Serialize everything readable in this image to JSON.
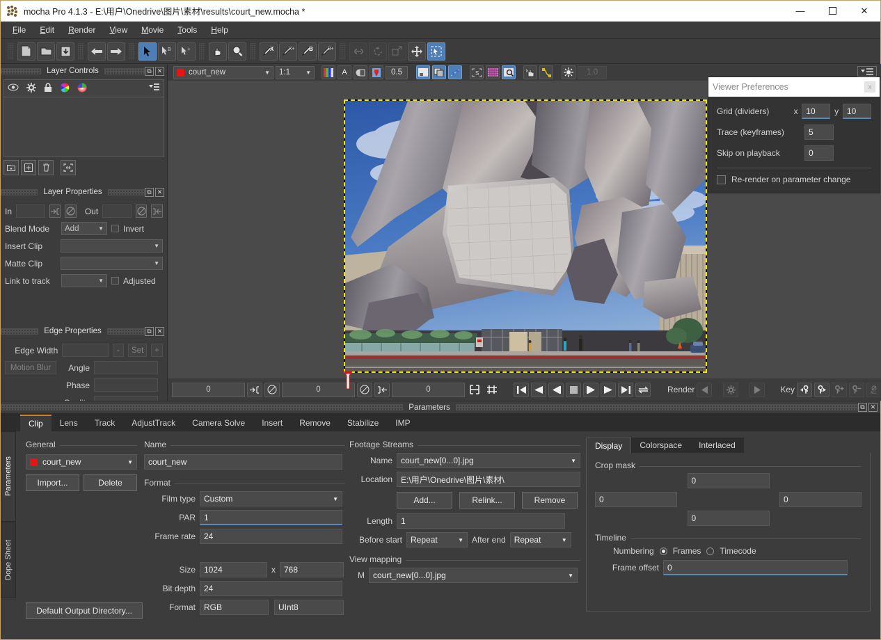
{
  "window": {
    "title": "mocha Pro 4.1.3 - E:\\用户\\Onedrive\\图片\\素材\\results\\court_new.mocha *",
    "minimize": "—",
    "maximize": "☐",
    "close": "✕"
  },
  "menu": [
    "File",
    "Edit",
    "Render",
    "View",
    "Movie",
    "Tools",
    "Help"
  ],
  "toolbar": {
    "icons": [
      "new-icon",
      "open-icon",
      "save-icon",
      "back-arrow-icon",
      "forward-arrow-icon",
      "select-pointer-icon",
      "select-b-pointer-icon",
      "add-pointer-icon",
      "pan-hand-icon",
      "zoom-magnifier-icon",
      "pen-x-icon",
      "pen-xplus-icon",
      "pen-b-icon",
      "pen-bplus-icon",
      "link-icon",
      "rotate-icon",
      "transform-icon",
      "move-icon",
      "marquee-select-icon"
    ]
  },
  "layer_controls": {
    "title": "Layer Controls",
    "toolbar_icons": [
      "eye-icon",
      "gear-icon",
      "lock-icon",
      "color-wheel-icon",
      "color-picker-icon",
      "menu-icon"
    ],
    "footer_icons": [
      "new-folder-icon",
      "new-layer-icon",
      "trash-icon",
      "fit-icon"
    ],
    "panel_buttons": [
      "float-icon",
      "close-icon"
    ]
  },
  "layer_properties": {
    "title": "Layer Properties",
    "in_label": "In",
    "in_value": "",
    "out_label": "Out",
    "out_value": "",
    "blend_mode_label": "Blend Mode",
    "blend_mode_value": "Add",
    "invert_label": "Invert",
    "insert_clip_label": "Insert Clip",
    "insert_clip_value": "",
    "matte_clip_label": "Matte Clip",
    "matte_clip_value": "",
    "link_to_track_label": "Link to track",
    "link_to_track_value": "",
    "adjusted_label": "Adjusted"
  },
  "edge_properties": {
    "title": "Edge Properties",
    "edge_width_label": "Edge Width",
    "edge_width_value": "",
    "minus_label": "-",
    "set_label": "Set",
    "plus_label": "+",
    "motion_blur_label": "Motion Blur",
    "angle_label": "Angle",
    "angle_value": "",
    "phase_label": "Phase",
    "phase_value": "",
    "quality_label": "Quality",
    "quality_value": ""
  },
  "viewer_toolbar": {
    "layer_name": "court_new",
    "layer_color": "#e81313",
    "zoom_value": "1:1",
    "opacity_value": "0.5",
    "gain_value": "1.0",
    "icons": [
      "rgb-channels-icon",
      "alpha-icon",
      "overlay-icon",
      "matte-icon",
      "viewer-mode-icon",
      "stereo-icon",
      "track-points-icon",
      "surface-icon",
      "grid-icon",
      "zoom-region-icon",
      "hand-icon",
      "spline-icon",
      "brightness-icon"
    ]
  },
  "viewer_preferences": {
    "title": "Viewer Preferences",
    "close_label": "x",
    "grid_label": "Grid (dividers)",
    "grid_x_label": "x",
    "grid_x_value": "10",
    "grid_y_label": "y",
    "grid_y_value": "10",
    "trace_label": "Trace (keyframes)",
    "trace_value": "5",
    "skip_label": "Skip on playback",
    "skip_value": "0",
    "rerender_label": "Re-render on parameter change",
    "rerender_checked": false
  },
  "transport": {
    "in_value": "0",
    "mid_value": "0",
    "out_value": "0",
    "render_label": "Render",
    "key_label": "Key",
    "buttons": [
      "go-to-start-icon",
      "play-backward-icon",
      "step-backward-icon",
      "stop-icon",
      "step-forward-icon",
      "play-forward-icon",
      "go-to-end-icon",
      "loop-icon"
    ],
    "render_buttons": [
      "render-previous-icon",
      "render-settings-icon",
      "render-next-icon"
    ],
    "key_buttons": [
      "prev-key-icon",
      "next-key-icon",
      "add-key-icon",
      "delete-key-icon",
      "delete-all-keys-icon",
      "auto-key-icon",
      "unlink-key-icon"
    ]
  },
  "parameters": {
    "header_title": "Parameters",
    "side_tabs": [
      {
        "label": "Parameters",
        "active": true
      },
      {
        "label": "Dope Sheet",
        "active": false
      }
    ],
    "tabs": [
      {
        "label": "Clip",
        "active": true
      },
      {
        "label": "Lens",
        "active": false
      },
      {
        "label": "Track",
        "active": false
      },
      {
        "label": "AdjustTrack",
        "active": false
      },
      {
        "label": "Camera Solve",
        "active": false
      },
      {
        "label": "Insert",
        "active": false
      },
      {
        "label": "Remove",
        "active": false
      },
      {
        "label": "Stabilize",
        "active": false
      },
      {
        "label": "IMP",
        "active": false
      }
    ]
  },
  "clip_panel": {
    "general": {
      "group_label": "General",
      "clip_value": "court_new",
      "clip_color": "#e81313",
      "import_label": "Import...",
      "delete_label": "Delete",
      "default_output_label": "Default Output Directory..."
    },
    "name": {
      "group_label": "Name",
      "value": "court_new"
    },
    "format": {
      "group_label": "Format",
      "film_type_label": "Film type",
      "film_type_value": "Custom",
      "par_label": "PAR",
      "par_value": "1",
      "frame_rate_label": "Frame rate",
      "frame_rate_value": "24",
      "size_label": "Size",
      "size_w": "1024",
      "size_x": "x",
      "size_h": "768",
      "bit_depth_label": "Bit depth",
      "bit_depth_value": "24",
      "format_label": "Format",
      "format_value": "RGB",
      "format_type": "UInt8"
    },
    "footage_streams": {
      "group_label": "Footage Streams",
      "name_label": "Name",
      "name_value": "court_new[0...0].jpg",
      "location_label": "Location",
      "location_value": "E:\\用户\\Onedrive\\图片\\素材\\",
      "add_label": "Add...",
      "relink_label": "Relink...",
      "remove_label": "Remove",
      "length_label": "Length",
      "length_value": "1",
      "before_start_label": "Before start",
      "before_start_value": "Repeat",
      "after_end_label": "After end",
      "after_end_value": "Repeat"
    },
    "view_mapping": {
      "group_label": "View mapping",
      "m_label": "M",
      "m_value": "court_new[0...0].jpg"
    },
    "display": {
      "tabs": [
        {
          "label": "Display",
          "active": true
        },
        {
          "label": "Colorspace",
          "active": false
        },
        {
          "label": "Interlaced",
          "active": false
        }
      ],
      "crop_mask_label": "Crop mask",
      "crop_top": "0",
      "crop_left": "0",
      "crop_right": "0",
      "crop_bottom": "0",
      "timeline_label": "Timeline",
      "numbering_label": "Numbering",
      "frames_label": "Frames",
      "frames_selected": true,
      "timecode_label": "Timecode",
      "timecode_selected": false,
      "frame_offset_label": "Frame offset",
      "frame_offset_value": "0"
    }
  }
}
